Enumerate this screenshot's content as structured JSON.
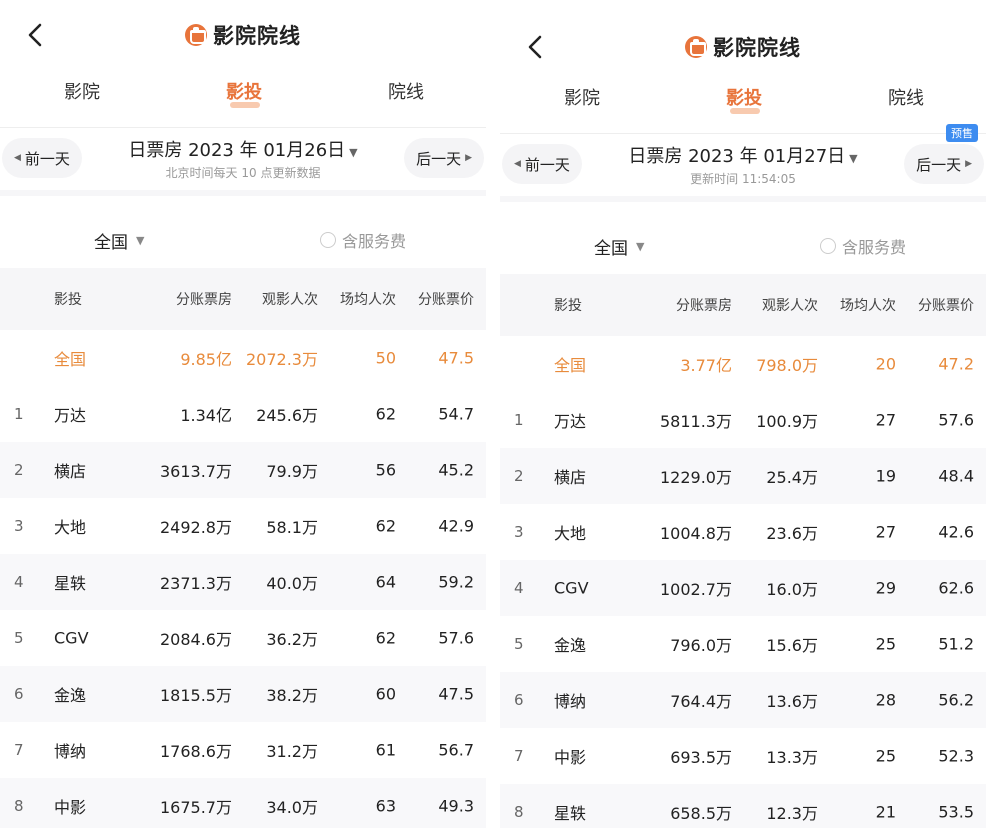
{
  "screens": [
    {
      "title": "影院院线",
      "tabs": [
        "影院",
        "影投",
        "院线"
      ],
      "active_tab": 1,
      "prev_day": "前一天",
      "next_day": "后一天",
      "date": "日票房 2023 年 01月26日",
      "date_sub": "北京时间每天 10 点更新数据",
      "badge": "",
      "region": "全国",
      "service_fee": "含服务费",
      "headers": [
        "影投",
        "分账票房",
        "观影人次",
        "场均人次",
        "分账票价"
      ],
      "total": {
        "name": "全国",
        "box": "9.85亿",
        "view": "2072.3万",
        "avg": "50",
        "price": "47.5"
      },
      "rows": [
        {
          "rank": "1",
          "name": "万达",
          "box": "1.34亿",
          "view": "245.6万",
          "avg": "62",
          "price": "54.7"
        },
        {
          "rank": "2",
          "name": "横店",
          "box": "3613.7万",
          "view": "79.9万",
          "avg": "56",
          "price": "45.2"
        },
        {
          "rank": "3",
          "name": "大地",
          "box": "2492.8万",
          "view": "58.1万",
          "avg": "62",
          "price": "42.9"
        },
        {
          "rank": "4",
          "name": "星轶",
          "box": "2371.3万",
          "view": "40.0万",
          "avg": "64",
          "price": "59.2"
        },
        {
          "rank": "5",
          "name": "CGV",
          "box": "2084.6万",
          "view": "36.2万",
          "avg": "62",
          "price": "57.6"
        },
        {
          "rank": "6",
          "name": "金逸",
          "box": "1815.5万",
          "view": "38.2万",
          "avg": "60",
          "price": "47.5"
        },
        {
          "rank": "7",
          "name": "博纳",
          "box": "1768.6万",
          "view": "31.2万",
          "avg": "61",
          "price": "56.7"
        },
        {
          "rank": "8",
          "name": "中影",
          "box": "1675.7万",
          "view": "34.0万",
          "avg": "63",
          "price": "49.3"
        }
      ]
    },
    {
      "title": "影院院线",
      "tabs": [
        "影院",
        "影投",
        "院线"
      ],
      "active_tab": 1,
      "prev_day": "前一天",
      "next_day": "后一天",
      "date": "日票房 2023 年 01月27日",
      "date_sub": "更新时间 11:54:05",
      "badge": "预售",
      "region": "全国",
      "service_fee": "含服务费",
      "headers": [
        "影投",
        "分账票房",
        "观影人次",
        "场均人次",
        "分账票价"
      ],
      "total": {
        "name": "全国",
        "box": "3.77亿",
        "view": "798.0万",
        "avg": "20",
        "price": "47.2"
      },
      "rows": [
        {
          "rank": "1",
          "name": "万达",
          "box": "5811.3万",
          "view": "100.9万",
          "avg": "27",
          "price": "57.6"
        },
        {
          "rank": "2",
          "name": "横店",
          "box": "1229.0万",
          "view": "25.4万",
          "avg": "19",
          "price": "48.4"
        },
        {
          "rank": "3",
          "name": "大地",
          "box": "1004.8万",
          "view": "23.6万",
          "avg": "27",
          "price": "42.6"
        },
        {
          "rank": "4",
          "name": "CGV",
          "box": "1002.7万",
          "view": "16.0万",
          "avg": "29",
          "price": "62.6"
        },
        {
          "rank": "5",
          "name": "金逸",
          "box": "796.0万",
          "view": "15.6万",
          "avg": "25",
          "price": "51.2"
        },
        {
          "rank": "6",
          "name": "博纳",
          "box": "764.4万",
          "view": "13.6万",
          "avg": "28",
          "price": "56.2"
        },
        {
          "rank": "7",
          "name": "中影",
          "box": "693.5万",
          "view": "13.3万",
          "avg": "25",
          "price": "52.3"
        },
        {
          "rank": "8",
          "name": "星轶",
          "box": "658.5万",
          "view": "12.3万",
          "avg": "21",
          "price": "53.5"
        }
      ]
    }
  ]
}
